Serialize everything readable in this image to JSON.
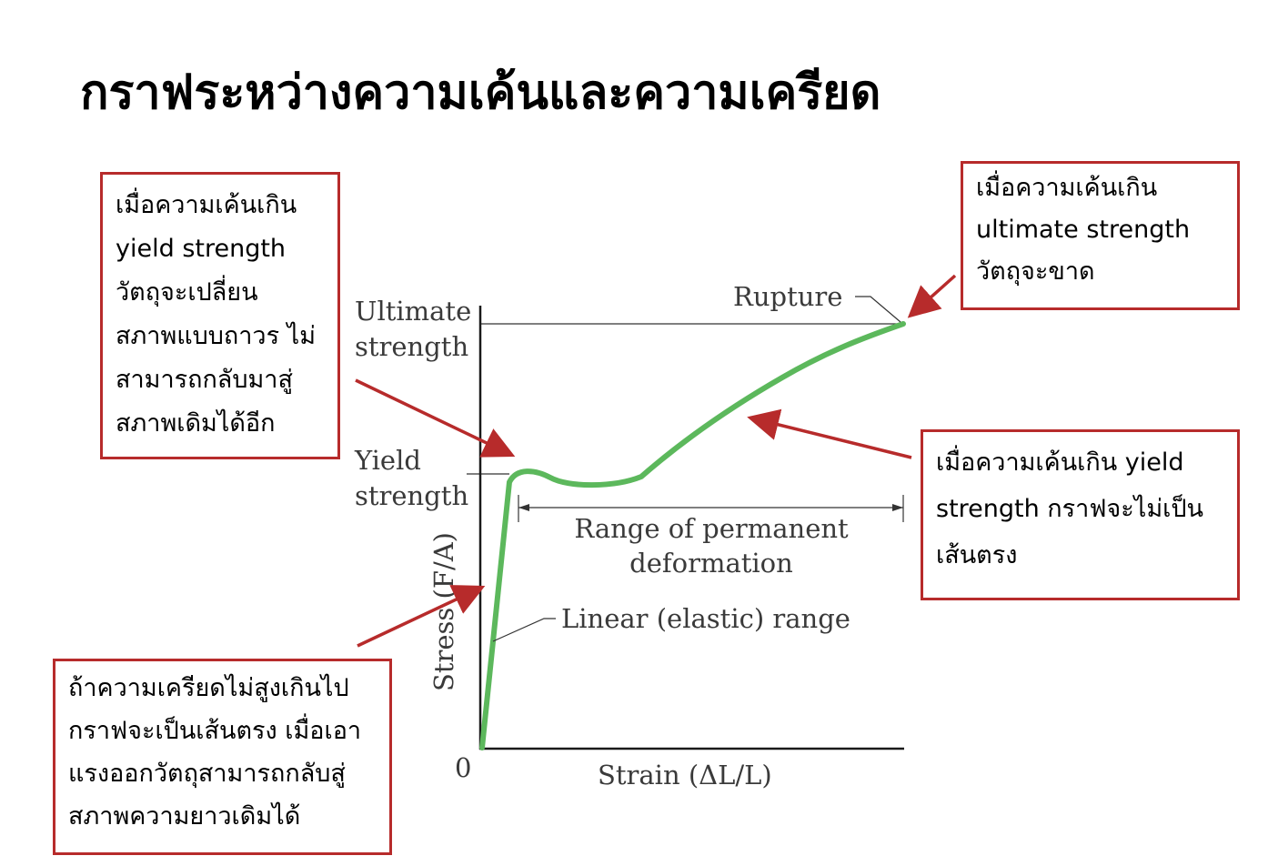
{
  "title": "กราฟระหว่างความเค้นและความเครียด",
  "callouts": {
    "yield": [
      "เมื่อความเค้นเกิน",
      "yield strength",
      "วัตถุจะเปลี่ยน",
      "สภาพแบบถาวร ไม่",
      "สามารถกลับมาสู่",
      "สภาพเดิมได้อีก"
    ],
    "ultimate": [
      "เมื่อความเค้นเกิน",
      "ultimate strength",
      "วัตถุจะขาด"
    ],
    "nonlinear": [
      "เมื่อความเค้นเกิน yield",
      "strength กราฟจะไม่เป็น",
      "เส้นตรง"
    ],
    "linear": [
      "ถ้าความเครียดไม่สูงเกินไป",
      "กราฟจะเป็นเส้นตรง เมื่อเอา",
      "แรงออกวัตถุสามารถกลับสู่",
      "สภาพความยาวเดิมได้"
    ]
  },
  "diagram": {
    "ultimate_label": [
      "Ultimate",
      "strength"
    ],
    "yield_label": [
      "Yield",
      "strength"
    ],
    "rupture_label": "Rupture",
    "range_label": [
      "Range of permanent",
      "deformation"
    ],
    "linear_label": "Linear (elastic) range",
    "y_axis_label": "Stress (F/A)",
    "x_axis_label": "Strain (ΔL/L)",
    "origin_label": "0"
  },
  "colors": {
    "curve": "#5cb85c",
    "arrow": "#b72b2b",
    "box_border": "#b72b2b",
    "axis": "#1a1a1a"
  }
}
